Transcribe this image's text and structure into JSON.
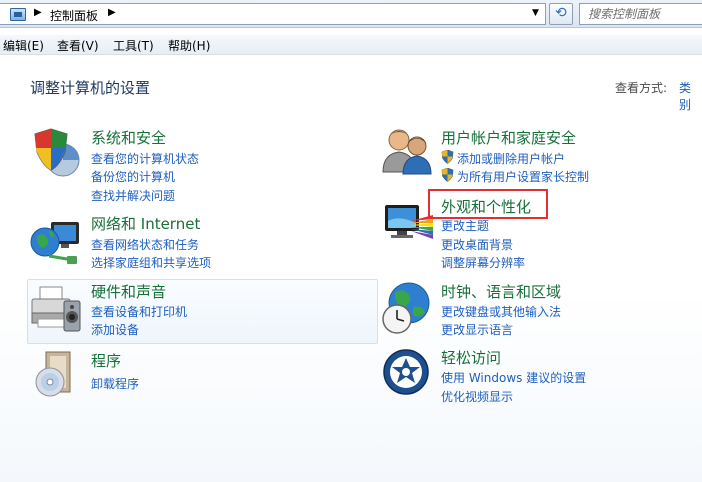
{
  "address_bar": {
    "breadcrumb": "控制面板",
    "search_placeholder": "搜索控制面板"
  },
  "menu": [
    "编辑(E)",
    "查看(V)",
    "工具(T)",
    "帮助(H)"
  ],
  "page": {
    "title": "调整计算机的设置",
    "view_by_label": "查看方式:",
    "view_by_value": "类别"
  },
  "categories": [
    {
      "title": "系统和安全",
      "icon": "system-security-icon",
      "links": [
        "查看您的计算机状态",
        "备份您的计算机",
        "查找并解决问题"
      ]
    },
    {
      "title": "网络和 Internet",
      "icon": "network-icon",
      "links": [
        "查看网络状态和任务",
        "选择家庭组和共享选项"
      ]
    },
    {
      "title": "硬件和声音",
      "icon": "printer-icon",
      "links": [
        "查看设备和打印机",
        "添加设备"
      ]
    },
    {
      "title": "程序",
      "icon": "programs-icon",
      "links": [
        "卸载程序"
      ]
    },
    {
      "title": "用户帐户和家庭安全",
      "icon": "users-icon",
      "links": [
        "添加或删除用户帐户",
        "为所有用户设置家长控制"
      ]
    },
    {
      "title": "外观和个性化",
      "icon": "appearance-icon",
      "links": [
        "更改主题",
        "更改桌面背景",
        "调整屏幕分辨率"
      ]
    },
    {
      "title": "时钟、语言和区域",
      "icon": "clock-globe-icon",
      "links": [
        "更改键盘或其他输入法",
        "更改显示语言"
      ]
    },
    {
      "title": "轻松访问",
      "icon": "ease-of-access-icon",
      "links": [
        "使用 Windows 建议的设置",
        "优化视频显示"
      ]
    }
  ],
  "colors": {
    "category_title": "#17703a",
    "link": "#1f5fbf",
    "highlight_box": "#e23030"
  }
}
